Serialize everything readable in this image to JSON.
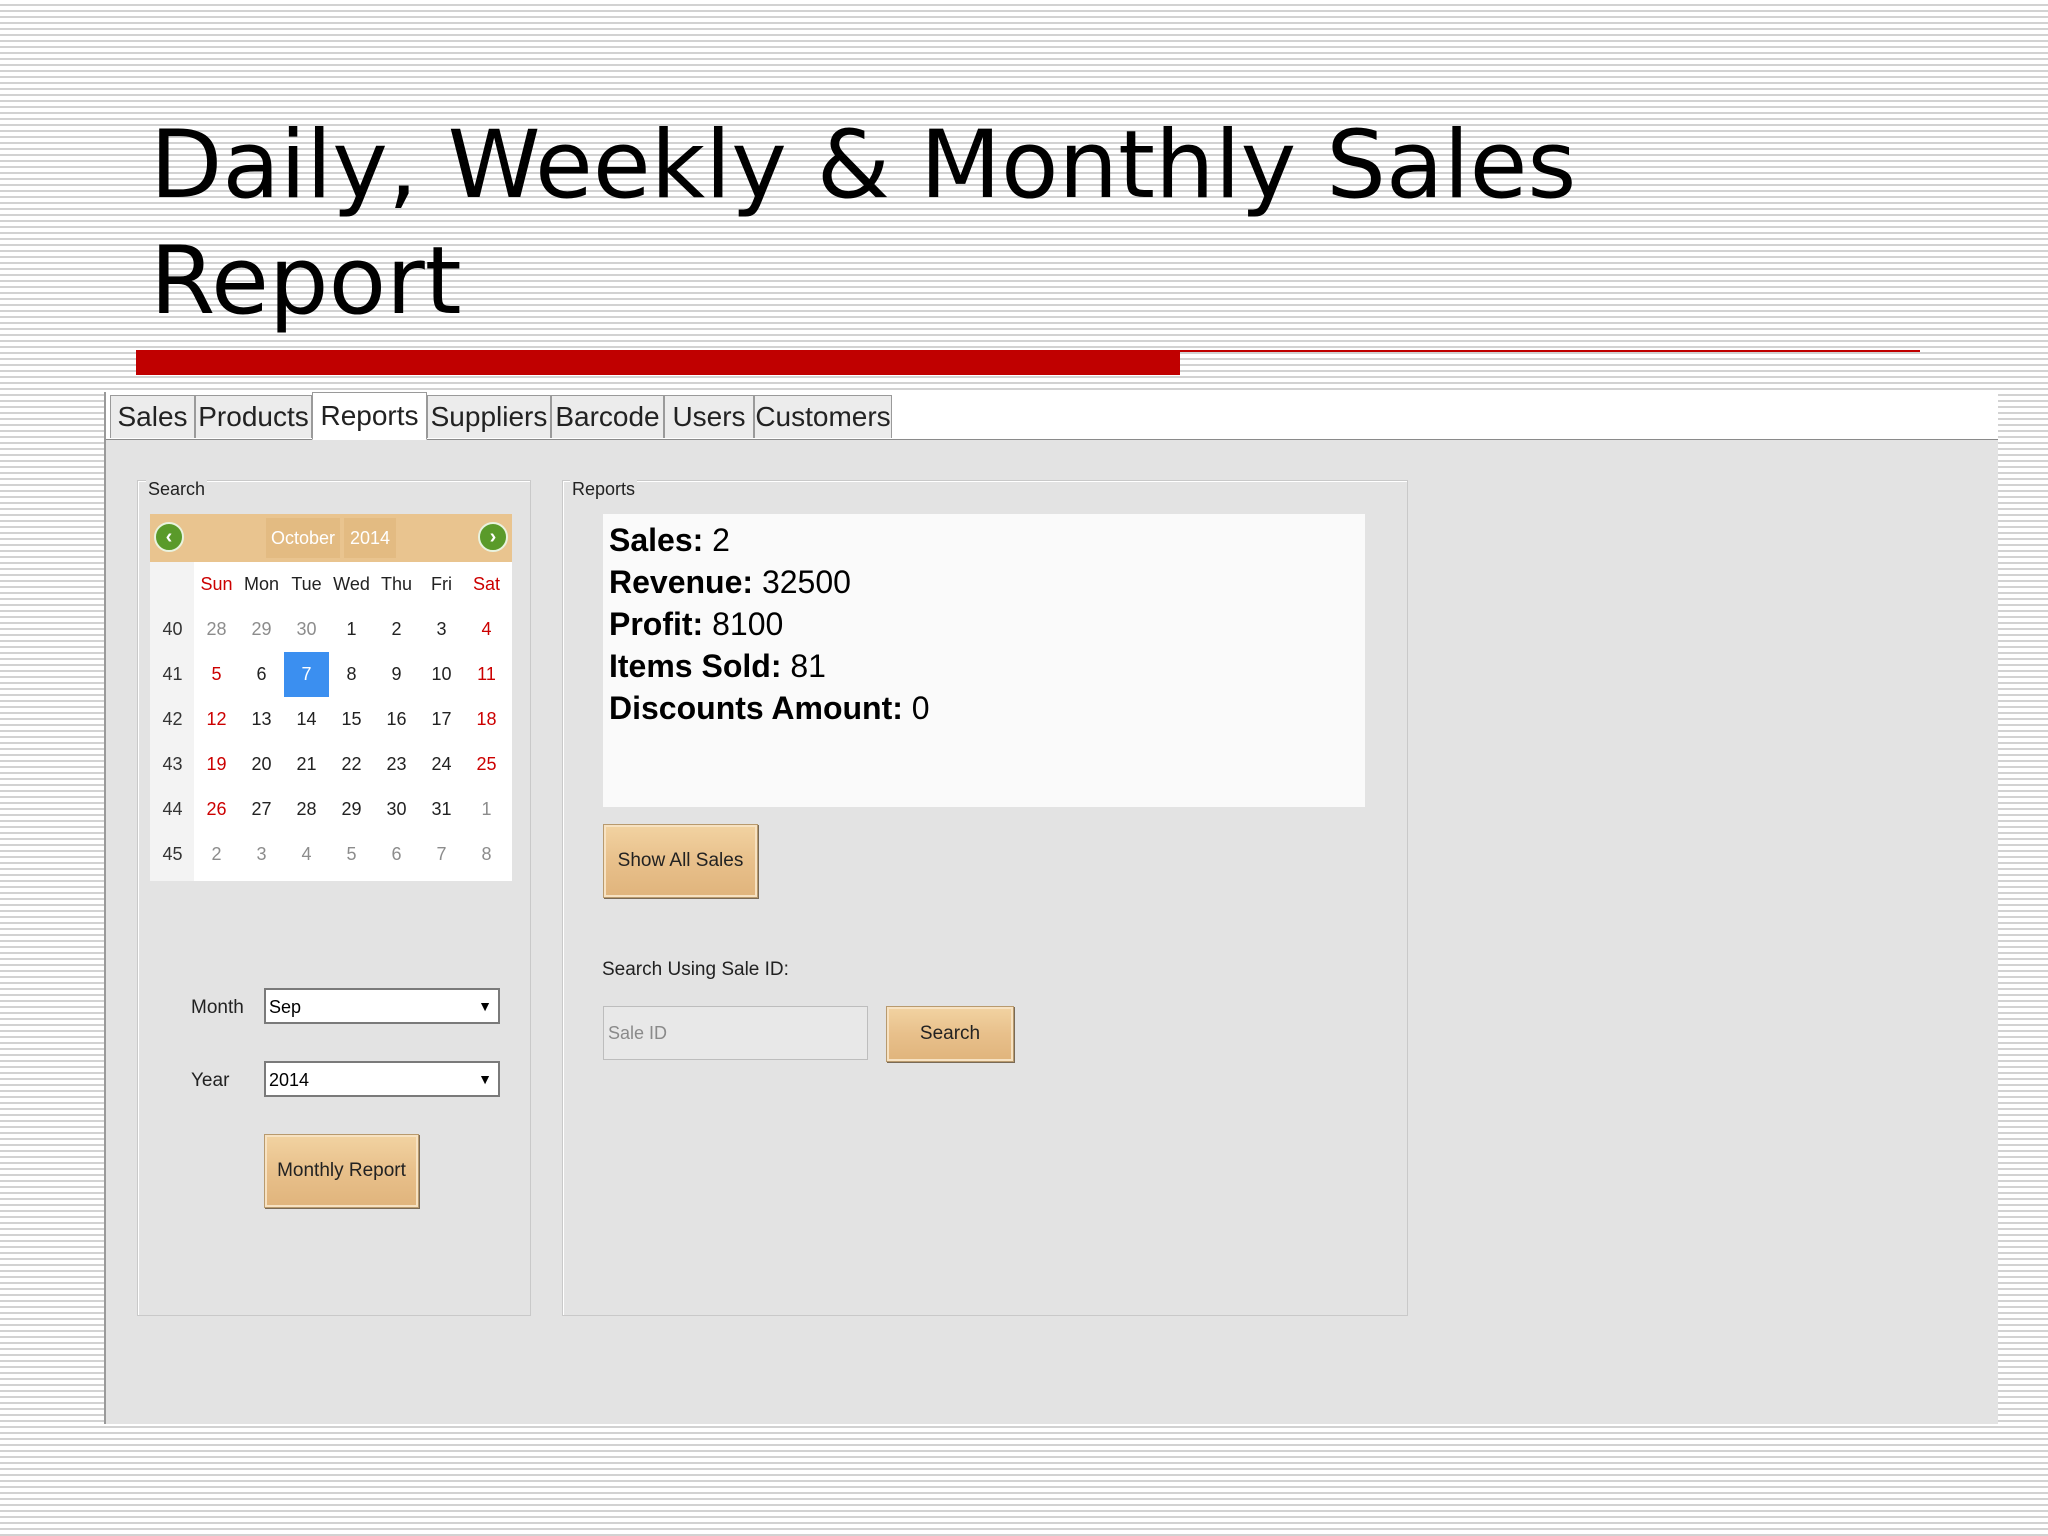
{
  "slide": {
    "title": "Daily, Weekly & Monthly Sales Report"
  },
  "tabs": [
    {
      "label": "Sales"
    },
    {
      "label": "Products"
    },
    {
      "label": "Reports"
    },
    {
      "label": "Suppliers"
    },
    {
      "label": "Barcode"
    },
    {
      "label": "Users"
    },
    {
      "label": "Customers"
    }
  ],
  "active_tab": "Reports",
  "search_panel": {
    "group_label": "Search",
    "calendar": {
      "month": "October",
      "year": "2014",
      "day_headers": [
        "Sun",
        "Mon",
        "Tue",
        "Wed",
        "Thu",
        "Fri",
        "Sat"
      ],
      "weeks": [
        {
          "week": "40",
          "days": [
            "28",
            "29",
            "30",
            "1",
            "2",
            "3",
            "4"
          ]
        },
        {
          "week": "41",
          "days": [
            "5",
            "6",
            "7",
            "8",
            "9",
            "10",
            "11"
          ]
        },
        {
          "week": "42",
          "days": [
            "12",
            "13",
            "14",
            "15",
            "16",
            "17",
            "18"
          ]
        },
        {
          "week": "43",
          "days": [
            "19",
            "20",
            "21",
            "22",
            "23",
            "24",
            "25"
          ]
        },
        {
          "week": "44",
          "days": [
            "26",
            "27",
            "28",
            "29",
            "30",
            "31",
            "1"
          ]
        },
        {
          "week": "45",
          "days": [
            "2",
            "3",
            "4",
            "5",
            "6",
            "7",
            "8"
          ]
        }
      ],
      "selected_day": "7"
    },
    "month_label": "Month",
    "month_value": "Sep",
    "year_label": "Year",
    "year_value": "2014",
    "monthly_report_button": "Monthly Report"
  },
  "reports_panel": {
    "group_label": "Reports",
    "summary": [
      {
        "label": "Sales:",
        "value": "2"
      },
      {
        "label": "Revenue:",
        "value": "32500"
      },
      {
        "label": "Profit:",
        "value": "8100"
      },
      {
        "label": "Items Sold:",
        "value": "81"
      },
      {
        "label": "Discounts Amount:",
        "value": "0"
      }
    ],
    "show_all_button": "Show All Sales",
    "search_label": "Search Using Sale ID:",
    "sale_id_placeholder": "Sale ID",
    "search_button": "Search"
  },
  "colors": {
    "accent_red": "#c00000",
    "selected_day": "#3b8ff0",
    "weekend_text": "#cc0000",
    "wood_button": "#e8c08b"
  },
  "icons": {
    "calendar_prev": "arrow-left-circle-icon",
    "calendar_next": "arrow-right-circle-icon",
    "combo_arrow": "caret-down-icon"
  }
}
